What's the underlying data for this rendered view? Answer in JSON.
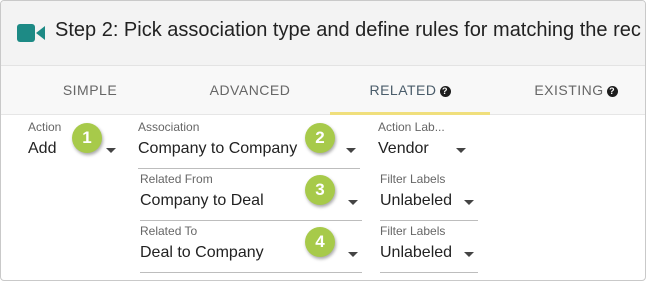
{
  "header": {
    "title": "Step 2: Pick association type and define rules for matching the rec",
    "icon": "video-camera-icon",
    "icon_color": "#1d8a85"
  },
  "tabs": [
    {
      "label": "SIMPLE",
      "help": false
    },
    {
      "label": "ADVANCED",
      "help": false
    },
    {
      "label": "RELATED",
      "help": true,
      "active": true
    },
    {
      "label": "EXISTING",
      "help": true
    }
  ],
  "help_glyph": "?",
  "accent_color": "#f0df7c",
  "badge_color": "#a7ca4a",
  "form": {
    "action": {
      "label": "Action",
      "value": "Add"
    },
    "association": {
      "label": "Association",
      "value": "Company to Company"
    },
    "action_label": {
      "label": "Action Lab...",
      "value": "Vendor"
    },
    "related_from": {
      "label": "Related From",
      "value": "Company to Deal"
    },
    "filter_labels_1": {
      "label": "Filter Labels",
      "value": "Unlabeled"
    },
    "related_to": {
      "label": "Related To",
      "value": "Deal to Company"
    },
    "filter_labels_2": {
      "label": "Filter Labels",
      "value": "Unlabeled"
    }
  },
  "badges": [
    "1",
    "2",
    "3",
    "4"
  ]
}
